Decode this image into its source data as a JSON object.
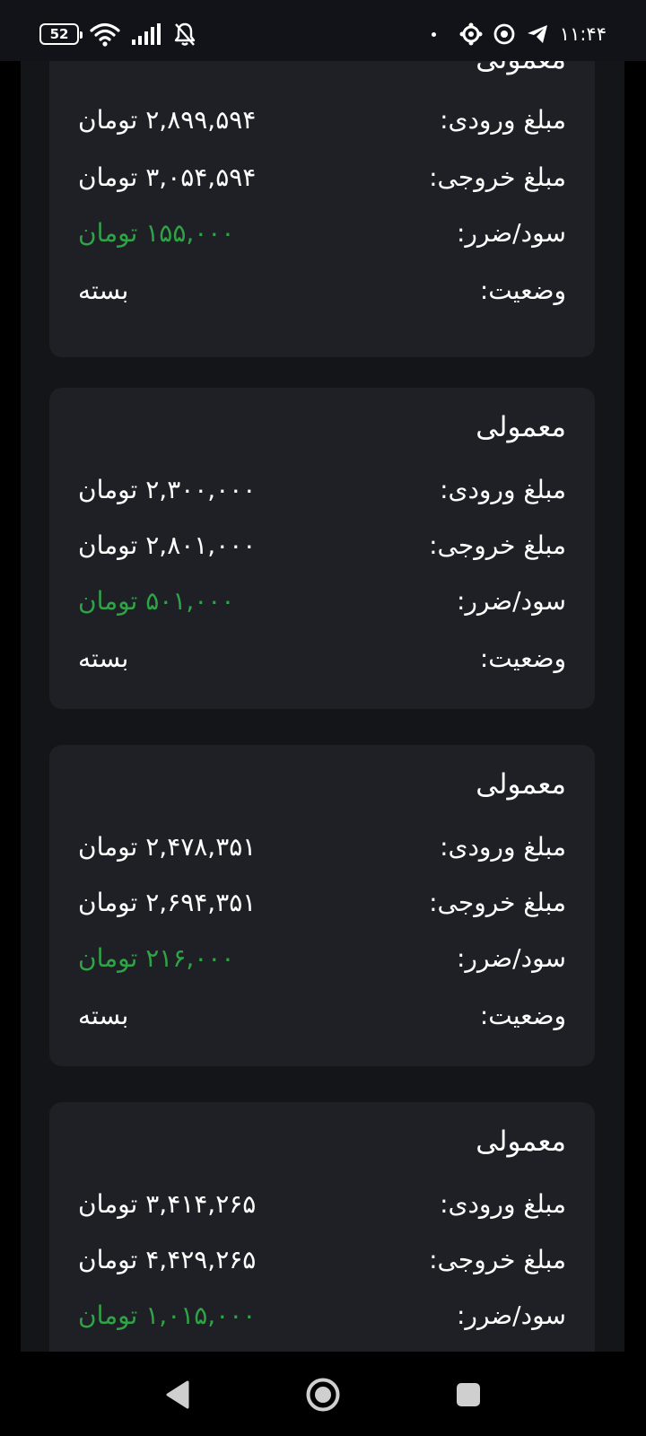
{
  "status_bar": {
    "battery_level": "52",
    "time": "۱۱:۴۴"
  },
  "labels": {
    "entry": "مبلغ ورودی:",
    "exit": "مبلغ خروجی:",
    "profit": "سود/ضرر:",
    "status": "وضعیت:"
  },
  "colors": {
    "profit_positive": "#2fa447",
    "card_background": "#1f2025",
    "page_background": "#141518"
  },
  "cards": [
    {
      "title": "معمولی",
      "entry": "۲,۸۹۹,۵۹۴ تومان",
      "exit": "۳,۰۵۴,۵۹۴ تومان",
      "profit": "۱۵۵,۰۰۰ تومان",
      "status": "بسته"
    },
    {
      "title": "معمولی",
      "entry": "۲,۳۰۰,۰۰۰ تومان",
      "exit": "۲,۸۰۱,۰۰۰ تومان",
      "profit": "۵۰۱,۰۰۰ تومان",
      "status": "بسته"
    },
    {
      "title": "معمولی",
      "entry": "۲,۴۷۸,۳۵۱ تومان",
      "exit": "۲,۶۹۴,۳۵۱ تومان",
      "profit": "۲۱۶,۰۰۰ تومان",
      "status": "بسته"
    },
    {
      "title": "معمولی",
      "entry": "۳,۴۱۴,۲۶۵ تومان",
      "exit": "۴,۴۲۹,۲۶۵ تومان",
      "profit": "۱,۰۱۵,۰۰۰ تومان"
    }
  ]
}
